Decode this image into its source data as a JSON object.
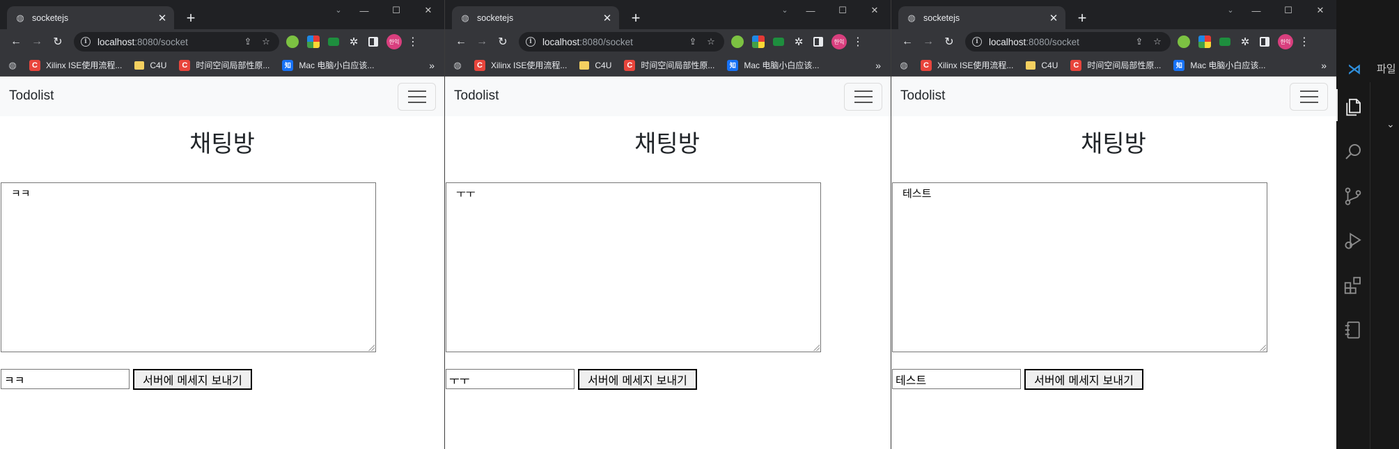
{
  "windows": [
    {
      "tab_title": "socketejs",
      "url_host": "localhost",
      "url_path": ":8080/socket",
      "avatar_text": "한익",
      "bookmarks": [
        {
          "label": "Xilinx ISE使用流程...",
          "icon": "C"
        },
        {
          "label": "C4U",
          "icon": "folder"
        },
        {
          "label": "时间空间局部性原...",
          "icon": "C"
        },
        {
          "label": "Mac 电脑小白应该...",
          "icon": "知"
        }
      ],
      "brand": "Todolist",
      "heading": "채팅방",
      "chat_log": "ㅋㅋ",
      "input_value": "ㅋㅋ",
      "send_label": "서버에 메세지 보내기"
    },
    {
      "tab_title": "socketejs",
      "url_host": "localhost",
      "url_path": ":8080/socket",
      "avatar_text": "한익",
      "bookmarks": [
        {
          "label": "Xilinx ISE使用流程...",
          "icon": "C"
        },
        {
          "label": "C4U",
          "icon": "folder"
        },
        {
          "label": "时间空间局部性原...",
          "icon": "C"
        },
        {
          "label": "Mac 电脑小白应该...",
          "icon": "知"
        }
      ],
      "brand": "Todolist",
      "heading": "채팅방",
      "chat_log": "ㅜㅜ",
      "input_value": "ㅜㅜ",
      "send_label": "서버에 메세지 보내기"
    },
    {
      "tab_title": "socketejs",
      "url_host": "localhost",
      "url_path": ":8080/socket",
      "avatar_text": "한익",
      "bookmarks": [
        {
          "label": "Xilinx ISE使用流程...",
          "icon": "C"
        },
        {
          "label": "C4U",
          "icon": "folder"
        },
        {
          "label": "时间空间局部性原...",
          "icon": "C"
        },
        {
          "label": "Mac 电脑小白应该...",
          "icon": "知"
        }
      ],
      "brand": "Todolist",
      "heading": "채팅방",
      "chat_log": "테스트",
      "input_value": "테스트",
      "send_label": "서버에 메세지 보내기"
    }
  ],
  "vscode": {
    "menu_label": "파일",
    "activity_icons": [
      "explorer-icon",
      "search-icon",
      "source-control-icon",
      "run-debug-icon",
      "extensions-icon",
      "notebook-icon"
    ]
  },
  "colors": {
    "chrome_dark": "#202124",
    "chrome_toolbar": "#35363a",
    "navbar_bg": "#f8f9fa",
    "vscode_bg": "#181818",
    "vscode_accent": "#2f8fdc"
  }
}
